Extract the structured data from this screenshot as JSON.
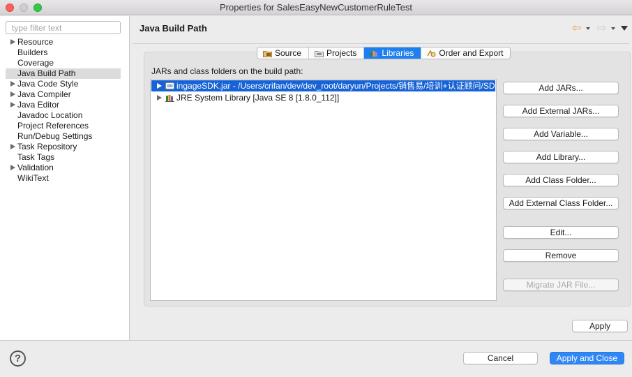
{
  "window": {
    "title": "Properties for SalesEasyNewCustomerRuleTest"
  },
  "sidebar": {
    "filter_placeholder": "type filter text",
    "items": [
      {
        "label": "Resource",
        "expandable": true
      },
      {
        "label": "Builders",
        "expandable": false
      },
      {
        "label": "Coverage",
        "expandable": false
      },
      {
        "label": "Java Build Path",
        "expandable": false,
        "selected": true
      },
      {
        "label": "Java Code Style",
        "expandable": true
      },
      {
        "label": "Java Compiler",
        "expandable": true
      },
      {
        "label": "Java Editor",
        "expandable": true
      },
      {
        "label": "Javadoc Location",
        "expandable": false
      },
      {
        "label": "Project References",
        "expandable": false
      },
      {
        "label": "Run/Debug Settings",
        "expandable": false
      },
      {
        "label": "Task Repository",
        "expandable": true
      },
      {
        "label": "Task Tags",
        "expandable": false
      },
      {
        "label": "Validation",
        "expandable": true
      },
      {
        "label": "WikiText",
        "expandable": false
      }
    ]
  },
  "page": {
    "title": "Java Build Path",
    "nav_icons": [
      "back-arrow-icon",
      "forward-arrow-icon",
      "view-menu-icon"
    ]
  },
  "tabs": [
    {
      "label": "Source",
      "icon": "source-folder-icon"
    },
    {
      "label": "Projects",
      "icon": "projects-icon"
    },
    {
      "label": "Libraries",
      "icon": "libraries-icon",
      "active": true
    },
    {
      "label": "Order and Export",
      "icon": "order-export-icon"
    }
  ],
  "libraries": {
    "label": "JARs and class folders on the build path:",
    "entries": [
      {
        "text": "ingageSDK.jar - /Users/crifan/dev/dev_root/daryun/Projects/销售易/培训+认证顾问/SDK",
        "icon": "jar-icon",
        "selected": true
      },
      {
        "text": "JRE System Library [Java SE 8 [1.8.0_112]]",
        "icon": "library-icon",
        "selected": false
      }
    ]
  },
  "buttons": {
    "add_jars": "Add JARs...",
    "add_external_jars": "Add External JARs...",
    "add_variable": "Add Variable...",
    "add_library": "Add Library...",
    "add_class_folder": "Add Class Folder...",
    "add_external_class_folder": "Add External Class Folder...",
    "edit": "Edit...",
    "remove": "Remove",
    "migrate_jar": "Migrate JAR File...",
    "apply": "Apply",
    "cancel": "Cancel",
    "apply_and_close": "Apply and Close"
  },
  "colors": {
    "selection": "#1763d6",
    "active_tab": "#1e80f0",
    "primary_button": "#2f87f6"
  }
}
